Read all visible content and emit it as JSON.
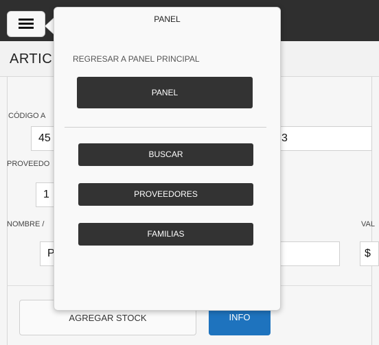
{
  "app": {
    "page_title": "ARTIC",
    "menu_icon": "hamburger-icon"
  },
  "form": {
    "labels": {
      "code": "CÓDIGO A",
      "supplier": "PROVEEDO",
      "name": "NOMBRE /",
      "value": "VAL"
    },
    "values": {
      "code": "45",
      "code_right": "3",
      "supplier": "1",
      "name": "P",
      "value": "$"
    }
  },
  "bottom": {
    "stock_button": "AGREGAR STOCK",
    "info_button": "INFO"
  },
  "panel": {
    "title": "PANEL",
    "subtitle": "REGRESAR A PANEL PRINCIPAL",
    "main_button": "PANEL",
    "items": [
      "BUSCAR",
      "PROVEEDORES",
      "FAMILIAS"
    ]
  },
  "colors": {
    "topbar": "#2f2f2f",
    "button_dark": "#333333",
    "accent_blue": "#1e73be"
  }
}
